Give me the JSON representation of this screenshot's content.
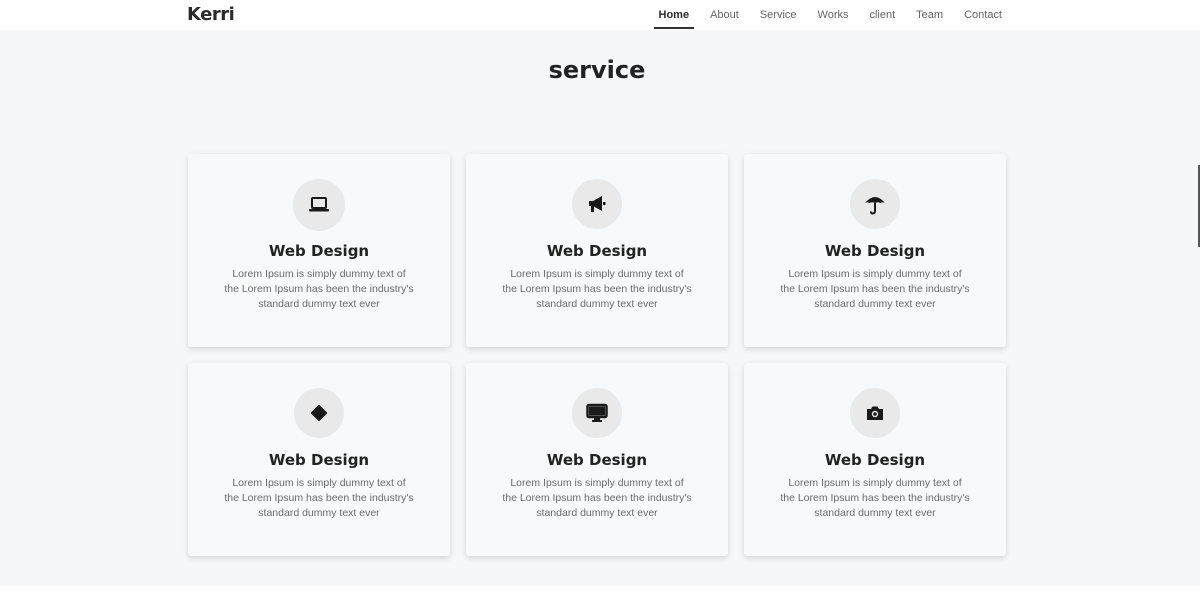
{
  "header": {
    "logo": "Kerri",
    "nav": [
      {
        "label": "Home",
        "active": true
      },
      {
        "label": "About",
        "active": false
      },
      {
        "label": "Service",
        "active": false
      },
      {
        "label": "Works",
        "active": false
      },
      {
        "label": "client",
        "active": false
      },
      {
        "label": "Team",
        "active": false
      },
      {
        "label": "Contact",
        "active": false
      }
    ]
  },
  "section": {
    "title": "service",
    "cards": [
      {
        "icon": "laptop-icon",
        "title": "Web Design",
        "text": "Lorem Ipsum is simply dummy text of the Lorem Ipsum has been the industry's standard dummy text ever"
      },
      {
        "icon": "megaphone-icon",
        "title": "Web Design",
        "text": "Lorem Ipsum is simply dummy text of the Lorem Ipsum has been the industry's standard dummy text ever"
      },
      {
        "icon": "umbrella-icon",
        "title": "Web Design",
        "text": "Lorem Ipsum is simply dummy text of the Lorem Ipsum has been the industry's standard dummy text ever"
      },
      {
        "icon": "diamond-icon",
        "title": "Web Design",
        "text": "Lorem Ipsum is simply dummy text of the Lorem Ipsum has been the industry's standard dummy text ever"
      },
      {
        "icon": "desktop-icon",
        "title": "Web Design",
        "text": "Lorem Ipsum is simply dummy text of the Lorem Ipsum has been the industry's standard dummy text ever"
      },
      {
        "icon": "camera-icon",
        "title": "Web Design",
        "text": "Lorem Ipsum is simply dummy text of the Lorem Ipsum has been the industry's standard dummy text ever"
      }
    ]
  }
}
